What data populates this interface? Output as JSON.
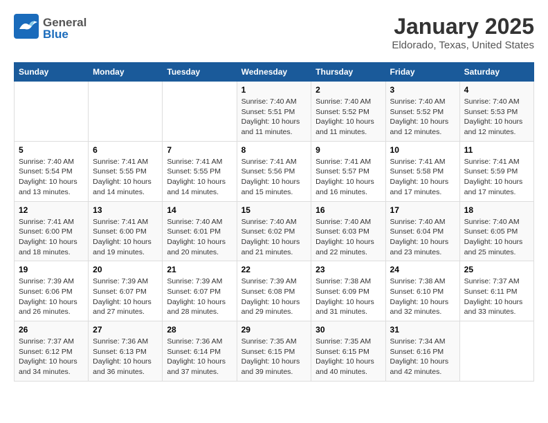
{
  "logo": {
    "general": "General",
    "blue": "Blue"
  },
  "title": "January 2025",
  "subtitle": "Eldorado, Texas, United States",
  "weekdays": [
    "Sunday",
    "Monday",
    "Tuesday",
    "Wednesday",
    "Thursday",
    "Friday",
    "Saturday"
  ],
  "weeks": [
    [
      {
        "day": "",
        "info": ""
      },
      {
        "day": "",
        "info": ""
      },
      {
        "day": "",
        "info": ""
      },
      {
        "day": "1",
        "info": "Sunrise: 7:40 AM\nSunset: 5:51 PM\nDaylight: 10 hours and 11 minutes."
      },
      {
        "day": "2",
        "info": "Sunrise: 7:40 AM\nSunset: 5:52 PM\nDaylight: 10 hours and 11 minutes."
      },
      {
        "day": "3",
        "info": "Sunrise: 7:40 AM\nSunset: 5:52 PM\nDaylight: 10 hours and 12 minutes."
      },
      {
        "day": "4",
        "info": "Sunrise: 7:40 AM\nSunset: 5:53 PM\nDaylight: 10 hours and 12 minutes."
      }
    ],
    [
      {
        "day": "5",
        "info": "Sunrise: 7:40 AM\nSunset: 5:54 PM\nDaylight: 10 hours and 13 minutes."
      },
      {
        "day": "6",
        "info": "Sunrise: 7:41 AM\nSunset: 5:55 PM\nDaylight: 10 hours and 14 minutes."
      },
      {
        "day": "7",
        "info": "Sunrise: 7:41 AM\nSunset: 5:55 PM\nDaylight: 10 hours and 14 minutes."
      },
      {
        "day": "8",
        "info": "Sunrise: 7:41 AM\nSunset: 5:56 PM\nDaylight: 10 hours and 15 minutes."
      },
      {
        "day": "9",
        "info": "Sunrise: 7:41 AM\nSunset: 5:57 PM\nDaylight: 10 hours and 16 minutes."
      },
      {
        "day": "10",
        "info": "Sunrise: 7:41 AM\nSunset: 5:58 PM\nDaylight: 10 hours and 17 minutes."
      },
      {
        "day": "11",
        "info": "Sunrise: 7:41 AM\nSunset: 5:59 PM\nDaylight: 10 hours and 17 minutes."
      }
    ],
    [
      {
        "day": "12",
        "info": "Sunrise: 7:41 AM\nSunset: 6:00 PM\nDaylight: 10 hours and 18 minutes."
      },
      {
        "day": "13",
        "info": "Sunrise: 7:41 AM\nSunset: 6:00 PM\nDaylight: 10 hours and 19 minutes."
      },
      {
        "day": "14",
        "info": "Sunrise: 7:40 AM\nSunset: 6:01 PM\nDaylight: 10 hours and 20 minutes."
      },
      {
        "day": "15",
        "info": "Sunrise: 7:40 AM\nSunset: 6:02 PM\nDaylight: 10 hours and 21 minutes."
      },
      {
        "day": "16",
        "info": "Sunrise: 7:40 AM\nSunset: 6:03 PM\nDaylight: 10 hours and 22 minutes."
      },
      {
        "day": "17",
        "info": "Sunrise: 7:40 AM\nSunset: 6:04 PM\nDaylight: 10 hours and 23 minutes."
      },
      {
        "day": "18",
        "info": "Sunrise: 7:40 AM\nSunset: 6:05 PM\nDaylight: 10 hours and 25 minutes."
      }
    ],
    [
      {
        "day": "19",
        "info": "Sunrise: 7:39 AM\nSunset: 6:06 PM\nDaylight: 10 hours and 26 minutes."
      },
      {
        "day": "20",
        "info": "Sunrise: 7:39 AM\nSunset: 6:07 PM\nDaylight: 10 hours and 27 minutes."
      },
      {
        "day": "21",
        "info": "Sunrise: 7:39 AM\nSunset: 6:07 PM\nDaylight: 10 hours and 28 minutes."
      },
      {
        "day": "22",
        "info": "Sunrise: 7:39 AM\nSunset: 6:08 PM\nDaylight: 10 hours and 29 minutes."
      },
      {
        "day": "23",
        "info": "Sunrise: 7:38 AM\nSunset: 6:09 PM\nDaylight: 10 hours and 31 minutes."
      },
      {
        "day": "24",
        "info": "Sunrise: 7:38 AM\nSunset: 6:10 PM\nDaylight: 10 hours and 32 minutes."
      },
      {
        "day": "25",
        "info": "Sunrise: 7:37 AM\nSunset: 6:11 PM\nDaylight: 10 hours and 33 minutes."
      }
    ],
    [
      {
        "day": "26",
        "info": "Sunrise: 7:37 AM\nSunset: 6:12 PM\nDaylight: 10 hours and 34 minutes."
      },
      {
        "day": "27",
        "info": "Sunrise: 7:36 AM\nSunset: 6:13 PM\nDaylight: 10 hours and 36 minutes."
      },
      {
        "day": "28",
        "info": "Sunrise: 7:36 AM\nSunset: 6:14 PM\nDaylight: 10 hours and 37 minutes."
      },
      {
        "day": "29",
        "info": "Sunrise: 7:35 AM\nSunset: 6:15 PM\nDaylight: 10 hours and 39 minutes."
      },
      {
        "day": "30",
        "info": "Sunrise: 7:35 AM\nSunset: 6:15 PM\nDaylight: 10 hours and 40 minutes."
      },
      {
        "day": "31",
        "info": "Sunrise: 7:34 AM\nSunset: 6:16 PM\nDaylight: 10 hours and 42 minutes."
      },
      {
        "day": "",
        "info": ""
      }
    ]
  ]
}
